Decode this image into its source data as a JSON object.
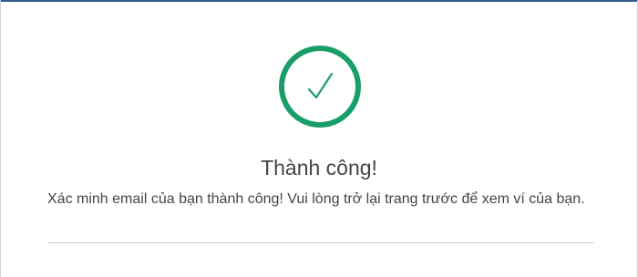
{
  "dialog": {
    "icon": "check-circle-icon",
    "accent_color": "#1a9e69",
    "title": "Thành công!",
    "message": "Xác minh email của bạn thành công! Vui lòng trở lại trang trước để xem ví của bạn."
  }
}
